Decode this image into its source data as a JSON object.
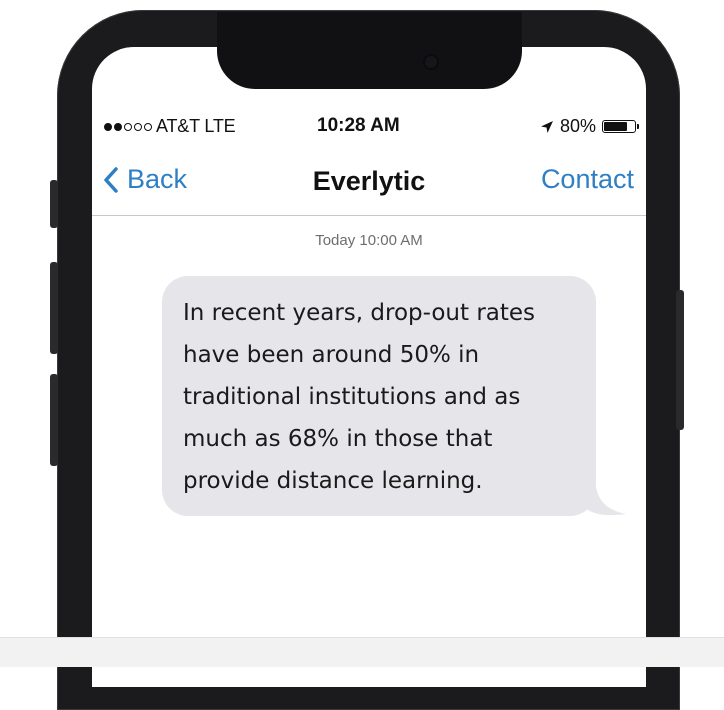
{
  "status_bar": {
    "carrier": "AT&T LTE",
    "signal_filled": 2,
    "signal_total": 5,
    "time": "10:28 AM",
    "battery": "80%",
    "battery_level": 0.8
  },
  "nav": {
    "back_label": "Back",
    "title": "Everlytic",
    "contact_label": "Contact"
  },
  "thread": {
    "timestamp": "Today 10:00 AM",
    "messages": [
      {
        "lines": [
          "In recent years, drop-out rates",
          "have been around 50% in",
          "traditional institutions and as",
          "much as 68% in those that",
          "provide distance learning."
        ]
      }
    ]
  },
  "colors": {
    "ios_blue": "#2f7fc4",
    "bubble_gray": "#e5e5ea",
    "phone_frame": "#1b1b1d"
  },
  "icons": {
    "back": "chevron-left-icon",
    "location": "location-arrow-icon",
    "battery": "battery-icon"
  }
}
